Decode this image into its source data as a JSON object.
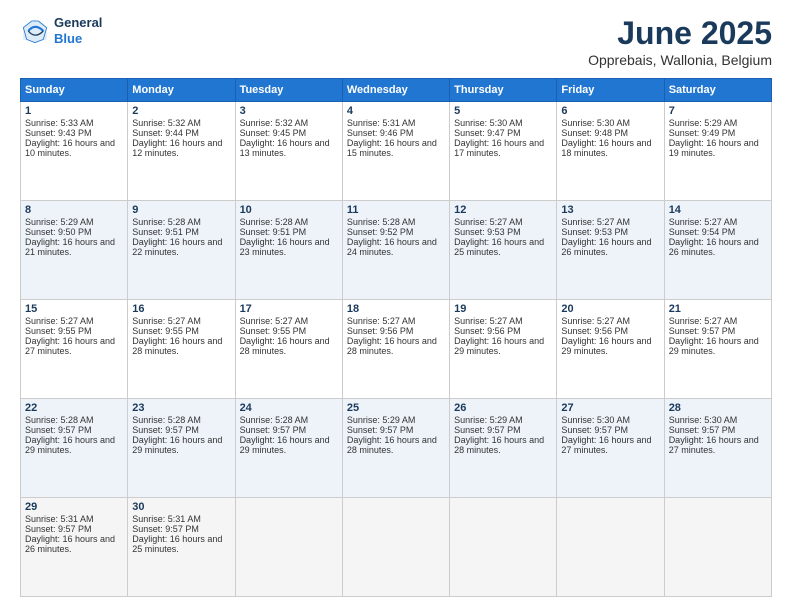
{
  "header": {
    "logo_line1": "General",
    "logo_line2": "Blue",
    "month_title": "June 2025",
    "location": "Opprebais, Wallonia, Belgium"
  },
  "weekdays": [
    "Sunday",
    "Monday",
    "Tuesday",
    "Wednesday",
    "Thursday",
    "Friday",
    "Saturday"
  ],
  "weeks": [
    [
      {
        "day": "1",
        "sunrise": "5:33 AM",
        "sunset": "9:43 PM",
        "daylight": "16 hours and 10 minutes."
      },
      {
        "day": "2",
        "sunrise": "5:32 AM",
        "sunset": "9:44 PM",
        "daylight": "16 hours and 12 minutes."
      },
      {
        "day": "3",
        "sunrise": "5:32 AM",
        "sunset": "9:45 PM",
        "daylight": "16 hours and 13 minutes."
      },
      {
        "day": "4",
        "sunrise": "5:31 AM",
        "sunset": "9:46 PM",
        "daylight": "16 hours and 15 minutes."
      },
      {
        "day": "5",
        "sunrise": "5:30 AM",
        "sunset": "9:47 PM",
        "daylight": "16 hours and 17 minutes."
      },
      {
        "day": "6",
        "sunrise": "5:30 AM",
        "sunset": "9:48 PM",
        "daylight": "16 hours and 18 minutes."
      },
      {
        "day": "7",
        "sunrise": "5:29 AM",
        "sunset": "9:49 PM",
        "daylight": "16 hours and 19 minutes."
      }
    ],
    [
      {
        "day": "8",
        "sunrise": "5:29 AM",
        "sunset": "9:50 PM",
        "daylight": "16 hours and 21 minutes."
      },
      {
        "day": "9",
        "sunrise": "5:28 AM",
        "sunset": "9:51 PM",
        "daylight": "16 hours and 22 minutes."
      },
      {
        "day": "10",
        "sunrise": "5:28 AM",
        "sunset": "9:51 PM",
        "daylight": "16 hours and 23 minutes."
      },
      {
        "day": "11",
        "sunrise": "5:28 AM",
        "sunset": "9:52 PM",
        "daylight": "16 hours and 24 minutes."
      },
      {
        "day": "12",
        "sunrise": "5:27 AM",
        "sunset": "9:53 PM",
        "daylight": "16 hours and 25 minutes."
      },
      {
        "day": "13",
        "sunrise": "5:27 AM",
        "sunset": "9:53 PM",
        "daylight": "16 hours and 26 minutes."
      },
      {
        "day": "14",
        "sunrise": "5:27 AM",
        "sunset": "9:54 PM",
        "daylight": "16 hours and 26 minutes."
      }
    ],
    [
      {
        "day": "15",
        "sunrise": "5:27 AM",
        "sunset": "9:55 PM",
        "daylight": "16 hours and 27 minutes."
      },
      {
        "day": "16",
        "sunrise": "5:27 AM",
        "sunset": "9:55 PM",
        "daylight": "16 hours and 28 minutes."
      },
      {
        "day": "17",
        "sunrise": "5:27 AM",
        "sunset": "9:55 PM",
        "daylight": "16 hours and 28 minutes."
      },
      {
        "day": "18",
        "sunrise": "5:27 AM",
        "sunset": "9:56 PM",
        "daylight": "16 hours and 28 minutes."
      },
      {
        "day": "19",
        "sunrise": "5:27 AM",
        "sunset": "9:56 PM",
        "daylight": "16 hours and 29 minutes."
      },
      {
        "day": "20",
        "sunrise": "5:27 AM",
        "sunset": "9:56 PM",
        "daylight": "16 hours and 29 minutes."
      },
      {
        "day": "21",
        "sunrise": "5:27 AM",
        "sunset": "9:57 PM",
        "daylight": "16 hours and 29 minutes."
      }
    ],
    [
      {
        "day": "22",
        "sunrise": "5:28 AM",
        "sunset": "9:57 PM",
        "daylight": "16 hours and 29 minutes."
      },
      {
        "day": "23",
        "sunrise": "5:28 AM",
        "sunset": "9:57 PM",
        "daylight": "16 hours and 29 minutes."
      },
      {
        "day": "24",
        "sunrise": "5:28 AM",
        "sunset": "9:57 PM",
        "daylight": "16 hours and 29 minutes."
      },
      {
        "day": "25",
        "sunrise": "5:29 AM",
        "sunset": "9:57 PM",
        "daylight": "16 hours and 28 minutes."
      },
      {
        "day": "26",
        "sunrise": "5:29 AM",
        "sunset": "9:57 PM",
        "daylight": "16 hours and 28 minutes."
      },
      {
        "day": "27",
        "sunrise": "5:30 AM",
        "sunset": "9:57 PM",
        "daylight": "16 hours and 27 minutes."
      },
      {
        "day": "28",
        "sunrise": "5:30 AM",
        "sunset": "9:57 PM",
        "daylight": "16 hours and 27 minutes."
      }
    ],
    [
      {
        "day": "29",
        "sunrise": "5:31 AM",
        "sunset": "9:57 PM",
        "daylight": "16 hours and 26 minutes."
      },
      {
        "day": "30",
        "sunrise": "5:31 AM",
        "sunset": "9:57 PM",
        "daylight": "16 hours and 25 minutes."
      },
      null,
      null,
      null,
      null,
      null
    ]
  ]
}
